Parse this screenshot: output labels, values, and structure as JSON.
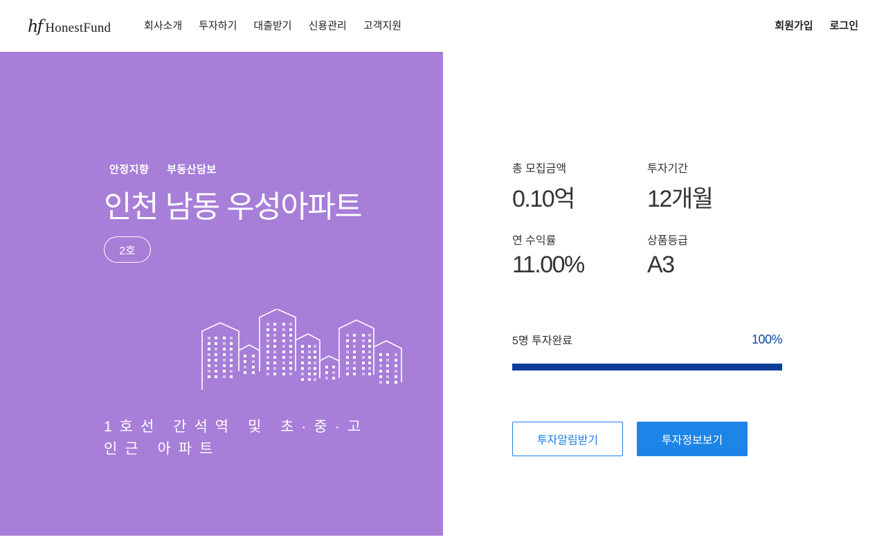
{
  "header": {
    "logo_mark": "hf",
    "logo_text": "HonestFund",
    "nav": [
      "회사소개",
      "투자하기",
      "대출받기",
      "신용관리",
      "고객지원"
    ],
    "auth": {
      "signup": "회원가입",
      "login": "로그인"
    }
  },
  "hero": {
    "tags": [
      "안정지향",
      "부동산담보"
    ],
    "title": "인천 남동 우성아파트",
    "badge": "2호",
    "description": "1호선 간석역 및 초·중·고 인근 아파트",
    "illustration_icon": "apartment-buildings-icon",
    "background_color": "#a77ed8"
  },
  "stats": {
    "total_amount": {
      "label": "총 모집금액",
      "value": "0.10억"
    },
    "period": {
      "label": "투자기간",
      "value": "12개월"
    },
    "annual_return": {
      "label": "연 수익률",
      "value": "11.00%"
    },
    "grade": {
      "label": "상품등급",
      "value": "A3"
    }
  },
  "progress": {
    "label": "5명 투자완료",
    "percent_text": "100%",
    "percent": 100,
    "color": "#0d3f9a"
  },
  "buttons": {
    "notify": "투자알림받기",
    "info": "투자정보보기",
    "accent_color": "#1e85e8"
  }
}
